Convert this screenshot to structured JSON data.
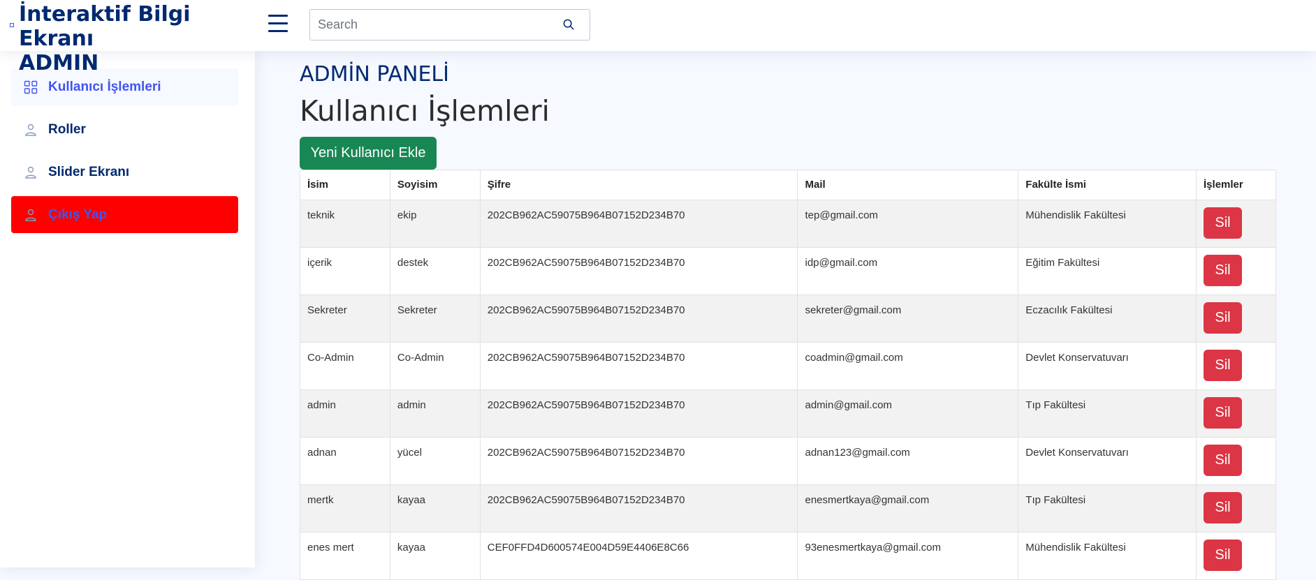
{
  "header": {
    "logo_text": "İnteraktif Bilgi Ekranı\nADMIN",
    "search_placeholder": "Search"
  },
  "sidebar": {
    "items": [
      {
        "label": "Kullanıcı İşlemleri",
        "icon": "grid-icon",
        "active": true
      },
      {
        "label": "Roller",
        "icon": "person-icon"
      },
      {
        "label": "Slider Ekranı",
        "icon": "person-icon"
      },
      {
        "label": "Çıkış Yap",
        "icon": "person-icon",
        "background": "#ff0000"
      }
    ]
  },
  "main": {
    "breadcrumb_title": "ADMİN PANELİ",
    "page_title": "Kullanıcı İşlemleri",
    "add_button_label": "Yeni Kullanıcı Ekle",
    "table": {
      "headers": [
        "İsim",
        "Soyisim",
        "Şifre",
        "Mail",
        "Fakülte İsmi",
        "İşlemler"
      ],
      "delete_label": "Sil",
      "rows": [
        {
          "isim": "teknik",
          "soyisim": "ekip",
          "sifre": "202CB962AC59075B964B07152D234B70",
          "mail": "tep@gmail.com",
          "fakulte": "Mühendislik Fakültesi"
        },
        {
          "isim": "içerik",
          "soyisim": "destek",
          "sifre": "202CB962AC59075B964B07152D234B70",
          "mail": "idp@gmail.com",
          "fakulte": "Eğitim Fakültesi"
        },
        {
          "isim": "Sekreter",
          "soyisim": "Sekreter",
          "sifre": "202CB962AC59075B964B07152D234B70",
          "mail": "sekreter@gmail.com",
          "fakulte": "Eczacılık Fakültesi"
        },
        {
          "isim": "Co-Admin",
          "soyisim": "Co-Admin",
          "sifre": "202CB962AC59075B964B07152D234B70",
          "mail": "coadmin@gmail.com",
          "fakulte": "Devlet Konservatuvarı"
        },
        {
          "isim": "admin",
          "soyisim": "admin",
          "sifre": "202CB962AC59075B964B07152D234B70",
          "mail": "admin@gmail.com",
          "fakulte": "Tıp Fakültesi"
        },
        {
          "isim": "adnan",
          "soyisim": "yücel",
          "sifre": "202CB962AC59075B964B07152D234B70",
          "mail": "adnan123@gmail.com",
          "fakulte": "Devlet Konservatuvarı"
        },
        {
          "isim": "mertk",
          "soyisim": "kayaa",
          "sifre": "202CB962AC59075B964B07152D234B70",
          "mail": "enesmertkaya@gmail.com",
          "fakulte": "Tıp Fakültesi"
        },
        {
          "isim": "enes mert",
          "soyisim": "kayaa",
          "sifre": "CEF0FFD4D600574E004D59E4406E8C66",
          "mail": "93enesmertkaya@gmail.com",
          "fakulte": "Mühendislik Fakültesi"
        }
      ]
    }
  },
  "colors": {
    "brand": "#012970",
    "accent": "#4154f1",
    "success": "#198754",
    "danger": "#dc3545",
    "logout": "#ff0000"
  }
}
